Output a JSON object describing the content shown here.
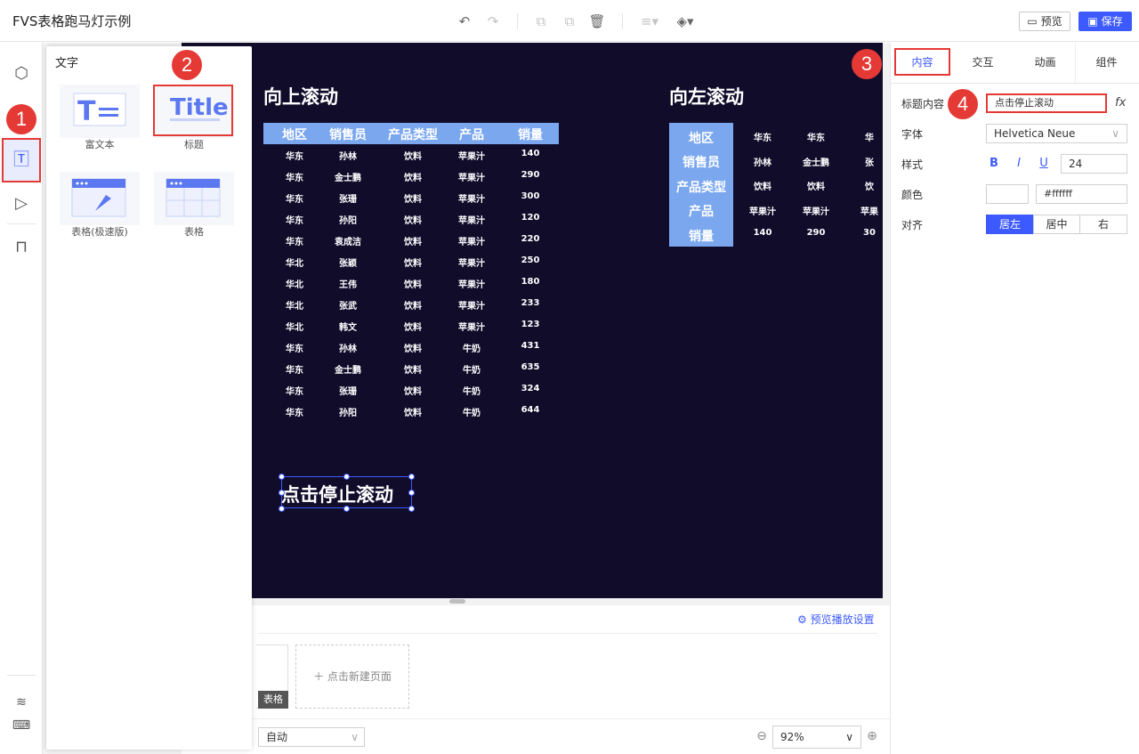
{
  "app": {
    "title": "FVS表格跑马灯示例"
  },
  "toolbar": {
    "preview": "预览",
    "save": "保存"
  },
  "popup": {
    "title": "文字",
    "items": [
      {
        "label": "富文本"
      },
      {
        "label": "标题",
        "icon_text": "Title"
      },
      {
        "label": "表格(极速版)"
      },
      {
        "label": "表格"
      }
    ]
  },
  "canvas": {
    "up_title": "向上滚动",
    "left_title": "向左滚动",
    "selected_title": "点击停止滚动",
    "up_table": {
      "headers": [
        "地区",
        "销售员",
        "产品类型",
        "产品",
        "销量"
      ],
      "rows": [
        [
          "华东",
          "孙林",
          "饮料",
          "苹果汁",
          "140"
        ],
        [
          "华东",
          "金士鹏",
          "饮料",
          "苹果汁",
          "290"
        ],
        [
          "华东",
          "张珊",
          "饮料",
          "苹果汁",
          "300"
        ],
        [
          "华东",
          "孙阳",
          "饮料",
          "苹果汁",
          "120"
        ],
        [
          "华东",
          "袁成洁",
          "饮料",
          "苹果汁",
          "220"
        ],
        [
          "华北",
          "张颖",
          "饮料",
          "苹果汁",
          "250"
        ],
        [
          "华北",
          "王伟",
          "饮料",
          "苹果汁",
          "180"
        ],
        [
          "华北",
          "张武",
          "饮料",
          "苹果汁",
          "233"
        ],
        [
          "华北",
          "韩文",
          "饮料",
          "苹果汁",
          "123"
        ],
        [
          "华东",
          "孙林",
          "饮料",
          "牛奶",
          "431"
        ],
        [
          "华东",
          "金士鹏",
          "饮料",
          "牛奶",
          "635"
        ],
        [
          "华东",
          "张珊",
          "饮料",
          "牛奶",
          "324"
        ],
        [
          "华东",
          "孙阳",
          "饮料",
          "牛奶",
          "644"
        ]
      ]
    },
    "left_table": {
      "headers": [
        "地区",
        "销售员",
        "产品类型",
        "产品",
        "销量"
      ],
      "cols": [
        [
          "华东",
          "孙林",
          "饮料",
          "苹果汁",
          "140"
        ],
        [
          "华东",
          "金士鹏",
          "饮料",
          "苹果汁",
          "290"
        ],
        [
          "华",
          "张",
          "饮",
          "苹果",
          "30"
        ]
      ]
    }
  },
  "bottom": {
    "preview_settings": "预览播放设置",
    "thumb_label": "表格",
    "new_page": "点击新建页面",
    "auto": "自动",
    "zoom": "92%"
  },
  "panel": {
    "tabs": [
      "内容",
      "交互",
      "动画",
      "组件"
    ],
    "title_label": "标题内容",
    "title_value": "点击停止滚动",
    "font_label": "字体",
    "font_value": "Helvetica Neue",
    "style_label": "样式",
    "font_size": "24",
    "color_label": "颜色",
    "color_value": "#ffffff",
    "align_label": "对齐",
    "align_options": [
      "居左",
      "居中",
      "右"
    ]
  },
  "badges": [
    "1",
    "2",
    "3",
    "4"
  ],
  "colors": {
    "accent": "#3d5afe",
    "highlight": "#e53935",
    "canvas_bg": "#120c2b",
    "table_header": "#7ba7ef"
  }
}
